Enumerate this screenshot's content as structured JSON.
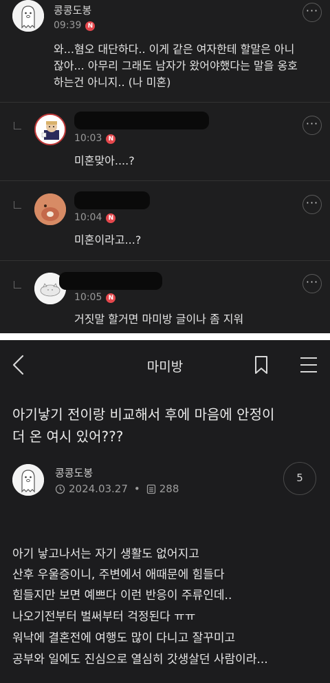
{
  "comments": [
    {
      "author": "콩콩도봉",
      "time": "09:39",
      "badge": "N",
      "text": [
        "와...혐오 대단하다.. 이게 같은 여자한테 할말은 아니",
        "잖아... 아무리 그래도 남자가 왔어야했다는 말을 옹호",
        "하는건 아니지.. (나 미혼)"
      ]
    },
    {
      "author": "",
      "time": "10:03",
      "badge": "N",
      "text": [
        "미혼맞아....?"
      ]
    },
    {
      "author": "",
      "time": "10:04",
      "badge": "N",
      "text": [
        "미혼이라고...?"
      ]
    },
    {
      "author": "",
      "time": "10:05",
      "badge": "N",
      "text": [
        "거짓말 할거면 마미방 글이나 좀 지워"
      ]
    }
  ],
  "more_label": "···",
  "header": {
    "title": "마미방",
    "back_icon": "back-chevron-icon",
    "bookmark_icon": "bookmark-icon",
    "menu_icon": "hamburger-menu-icon"
  },
  "post": {
    "title_lines": [
      "아기낳기 전이랑 비교해서 후에 마음에 안정이",
      "더 온 여시 있어???"
    ],
    "author": "콩콩도봉",
    "date": "2024.03.27",
    "dot": "•",
    "views": "288",
    "comment_count": "5",
    "body_lines": [
      "아기 낳고나서는 자기 생활도 없어지고",
      "산후 우울증이니, 주변에서 애때문에 힘들다",
      "힘들지만 보면 예쁘다 이런 반응이 주류인데..",
      "나오기전부터 벌써부터 걱정된다 ㅠㅠ",
      "워낙에 결혼전에 여행도 많이 다니고 잘꾸미고",
      "공부와 일에도 진심으로 열심히 갓생살던 사람이라..."
    ]
  }
}
